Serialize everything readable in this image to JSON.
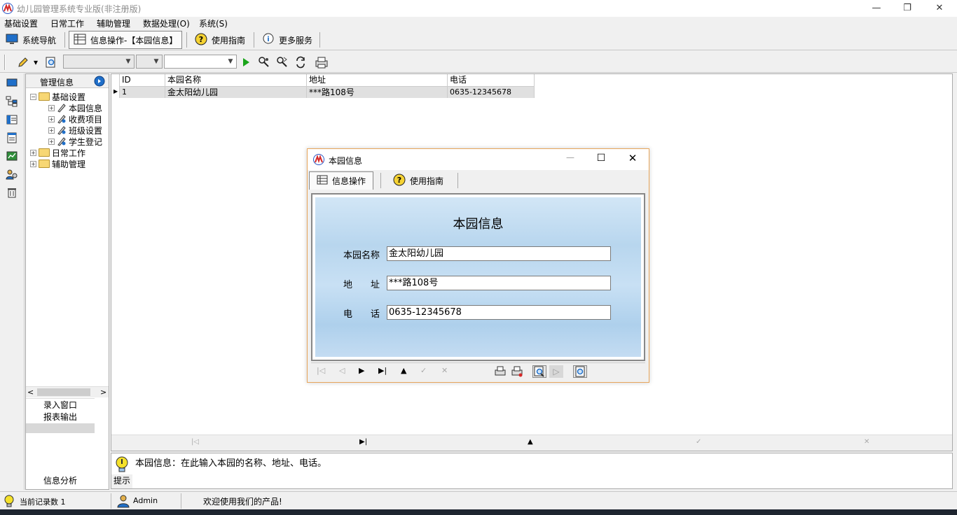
{
  "window": {
    "title": "幼儿园管理系统专业版(非注册版)"
  },
  "menu": [
    "基础设置",
    "日常工作",
    "辅助管理",
    "数据处理(O)",
    "系统(S)"
  ],
  "nav": {
    "system_nav": "系统导航",
    "info_ops": "信息操作-【本园信息】",
    "guide": "使用指南",
    "more": "更多服务"
  },
  "tree": {
    "header": "管理信息",
    "nodes": [
      {
        "label": "基础设置",
        "type": "folder",
        "expanded": true
      },
      {
        "label": "本园信息",
        "type": "leaf"
      },
      {
        "label": "收费项目",
        "type": "leaf"
      },
      {
        "label": "班级设置",
        "type": "leaf"
      },
      {
        "label": "学生登记",
        "type": "leaf"
      },
      {
        "label": "日常工作",
        "type": "folder",
        "expanded": false
      },
      {
        "label": "辅助管理",
        "type": "folder",
        "expanded": false
      }
    ],
    "lower": [
      "录入窗口",
      "报表输出"
    ],
    "bottom": "信息分析"
  },
  "grid": {
    "columns": [
      "ID",
      "本园名称",
      "地址",
      "电话"
    ],
    "rows": [
      [
        "1",
        "金太阳幼儿园",
        "***路108号",
        "0635-12345678"
      ]
    ]
  },
  "hint": {
    "text": "本园信息：在此输入本园的名称、地址、电话。",
    "label": "提示"
  },
  "status": {
    "record_count": "当前记录数 1",
    "user": "Admin",
    "welcome": "欢迎使用我们的产品!"
  },
  "dialog": {
    "title": "本园信息",
    "tabs": [
      "信息操作",
      "使用指南"
    ],
    "heading": "本园信息",
    "fields": [
      {
        "label": "本园名称",
        "value": "金太阳幼儿园"
      },
      {
        "label": "地　　址",
        "value": "***路108号"
      },
      {
        "label": "电　　话",
        "value": "0635-12345678"
      }
    ]
  },
  "colors": {
    "dialog_border": "#e8a65c",
    "panel": "#c8e0f4",
    "grid_row": "#e0e0e0"
  }
}
